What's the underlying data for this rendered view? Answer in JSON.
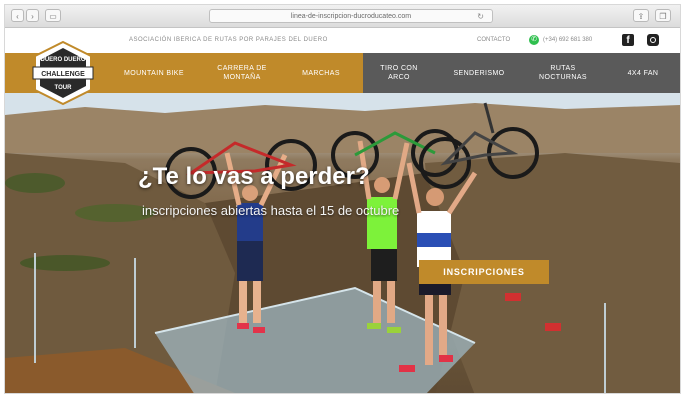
{
  "browser": {
    "back_label": "‹",
    "forward_label": "›",
    "sidebar_label": "▭",
    "url": "linea-de-inscripcion-ducroducateo.com",
    "reload_label": "↻",
    "share_label": "⇪",
    "tabs_label": "❐"
  },
  "topbar": {
    "association": "ASOCIACIÓN IBERICA DE RUTAS POR PARAJES DEL DUERO",
    "contact_label": "CONTACTO",
    "phone": "(+34) 692 681 380",
    "facebook_label": "f"
  },
  "logo": {
    "top_text": "DUERO DUERO",
    "main_text": "CHALLENGE",
    "bottom_text": "TOUR"
  },
  "nav": {
    "items": [
      {
        "label": "MOUNTAIN BIKE"
      },
      {
        "label": "CARRERA DE MONTAÑA"
      },
      {
        "label": "MARCHAS"
      },
      {
        "label": "TIRO CON ARCO"
      },
      {
        "label": "SENDERISMO"
      },
      {
        "label": "RUTAS NOCTURNAS"
      },
      {
        "label": "4X4 FAN"
      }
    ]
  },
  "hero": {
    "headline": "¿Te lo vas a perder?",
    "subline": "inscripciones abiertas hasta el 15 de octubre",
    "cta_label": "INSCRIPCIONES"
  },
  "colors": {
    "brand_gold": "#c08a2a",
    "nav_dark": "#5a5a5a"
  }
}
